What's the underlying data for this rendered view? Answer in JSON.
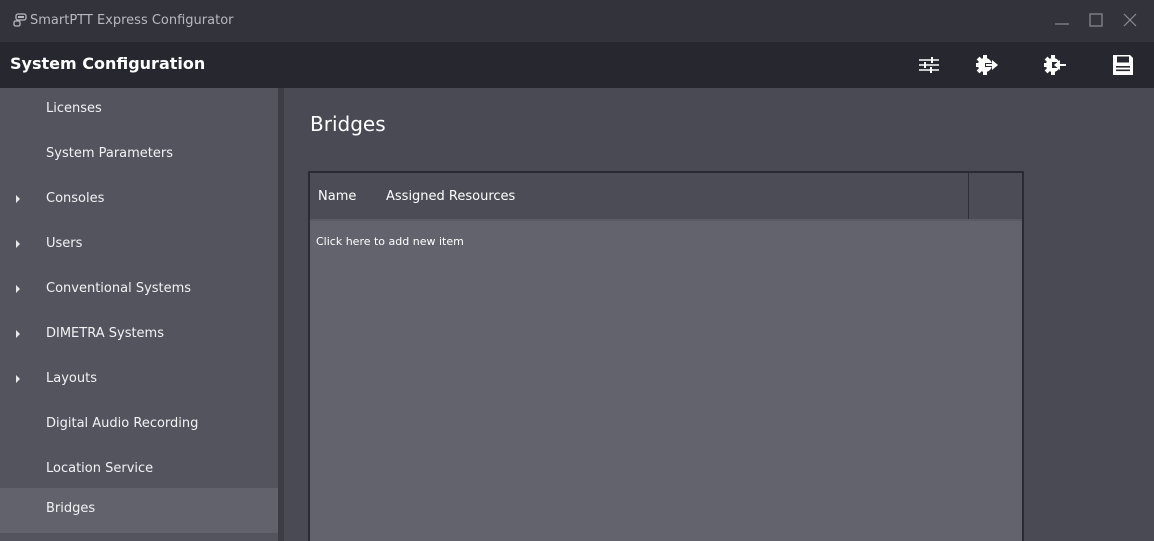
{
  "window": {
    "title": "SmartPTT Express Configurator",
    "icons": {
      "app": "radio-app-icon",
      "minimize": "minimize-icon",
      "maximize": "maximize-icon",
      "close": "close-icon"
    }
  },
  "toolbar": {
    "section_title": "System Configuration",
    "buttons": [
      {
        "name": "settings-sliders-icon"
      },
      {
        "name": "export-gear-icon"
      },
      {
        "name": "import-gear-icon"
      },
      {
        "name": "save-floppy-icon"
      }
    ]
  },
  "sidebar": {
    "items": [
      {
        "label": "Licenses",
        "expandable": false
      },
      {
        "label": "System Parameters",
        "expandable": false
      },
      {
        "label": "Consoles",
        "expandable": true
      },
      {
        "label": "Users",
        "expandable": true
      },
      {
        "label": "Conventional Systems",
        "expandable": true
      },
      {
        "label": "DIMETRA Systems",
        "expandable": true
      },
      {
        "label": "Layouts",
        "expandable": true
      },
      {
        "label": "Digital Audio Recording",
        "expandable": false
      },
      {
        "label": "Location Service",
        "expandable": false
      },
      {
        "label": "Bridges",
        "expandable": false,
        "selected": true
      }
    ]
  },
  "main": {
    "title": "Bridges",
    "table": {
      "columns": [
        "Name",
        "Assigned Resources"
      ],
      "add_item_text": "Click here to add new item",
      "rows": []
    }
  },
  "colors": {
    "titlebar": "#33333c",
    "toolbar": "#272730",
    "sidebar": "#54545f",
    "selected": "#62626d",
    "content": "#4a4a55",
    "grid_body": "#63636e"
  }
}
